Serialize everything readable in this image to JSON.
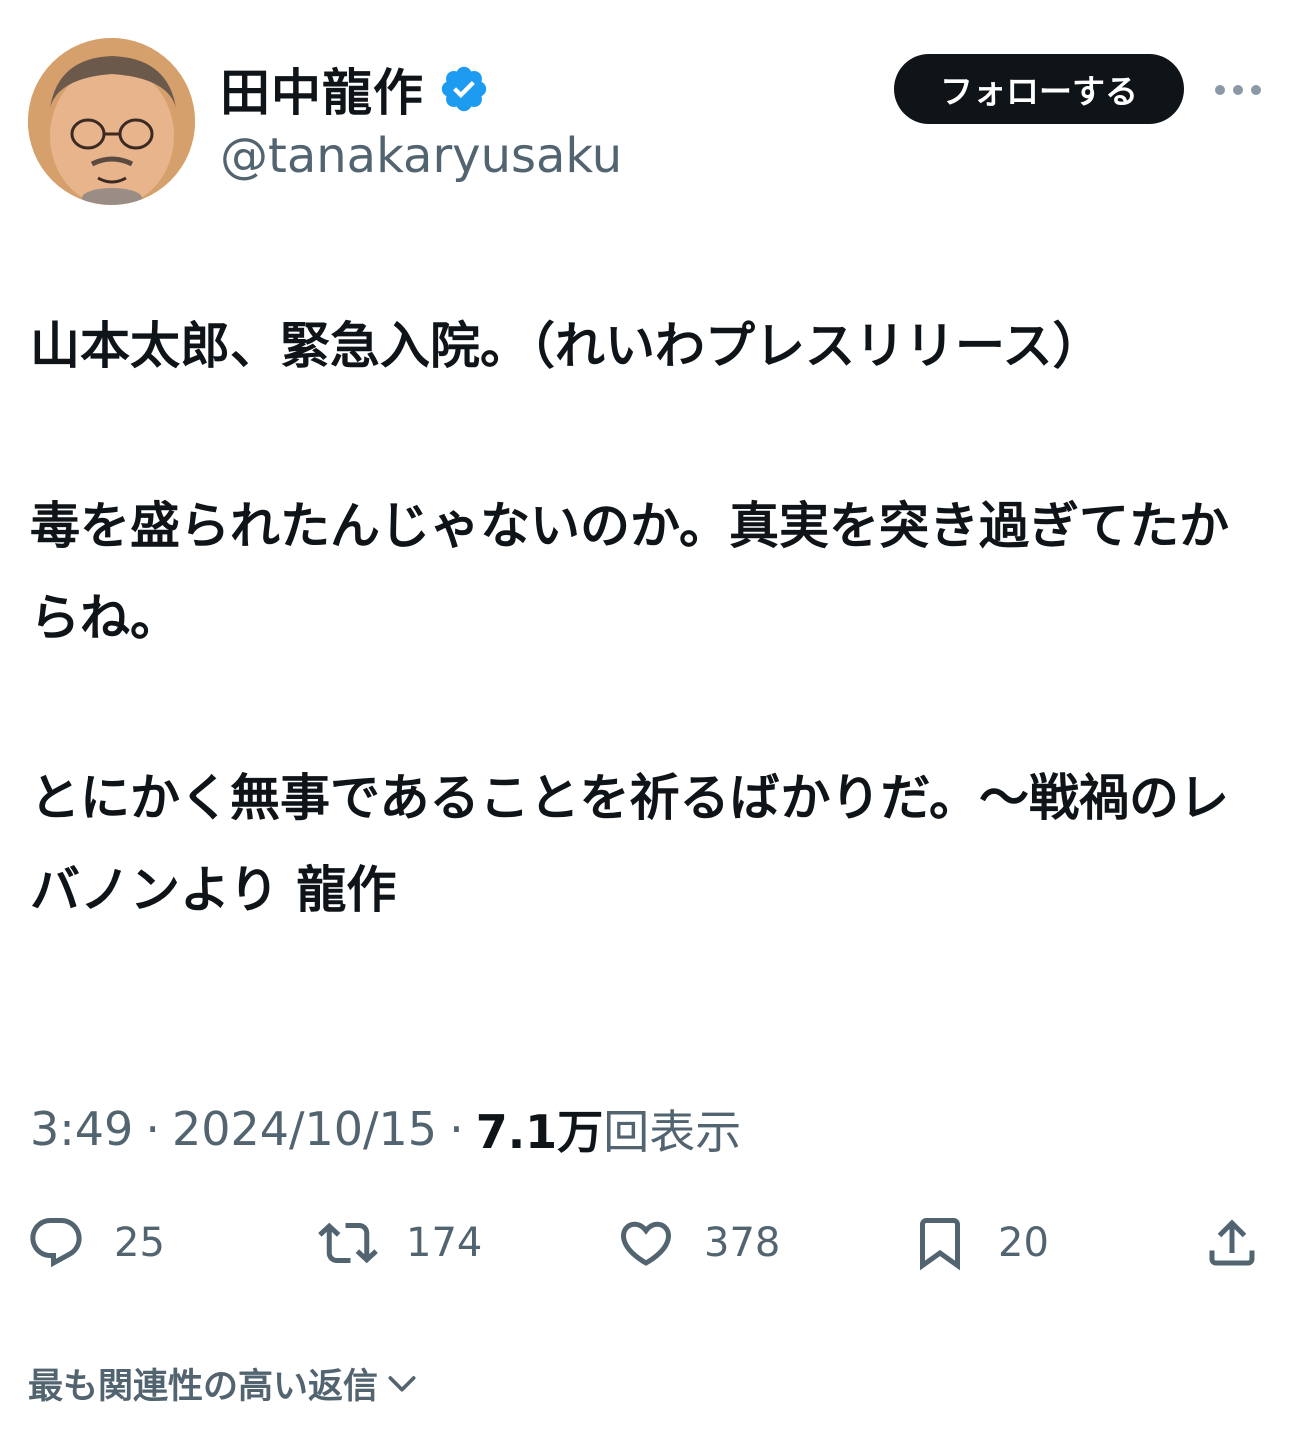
{
  "author": {
    "display_name": "田中龍作",
    "handle": "@tanakaryusaku",
    "verified": true
  },
  "header": {
    "follow_label": "フォローする"
  },
  "tweet": {
    "paragraphs": [
      "山本太郎、緊急入院。（れいわプレスリリース）",
      "毒を盛られたんじゃないのか。真実を突き過ぎてたからね。",
      "とにかく無事であることを祈るばかりだ。〜戦禍のレバノンより 龍作"
    ]
  },
  "meta": {
    "time": "3:49",
    "separator": "·",
    "date": "2024/10/15",
    "views_count": "7.1万",
    "views_label": "回表示"
  },
  "actions": {
    "reply_count": "25",
    "retweet_count": "174",
    "like_count": "378",
    "bookmark_count": "20"
  },
  "replies": {
    "sort_label": "最も関連性の高い返信"
  },
  "colors": {
    "text_primary": "#0f1419",
    "text_secondary": "#536471",
    "verified_blue": "#1d9bf0",
    "button_dark": "#0f1419"
  }
}
